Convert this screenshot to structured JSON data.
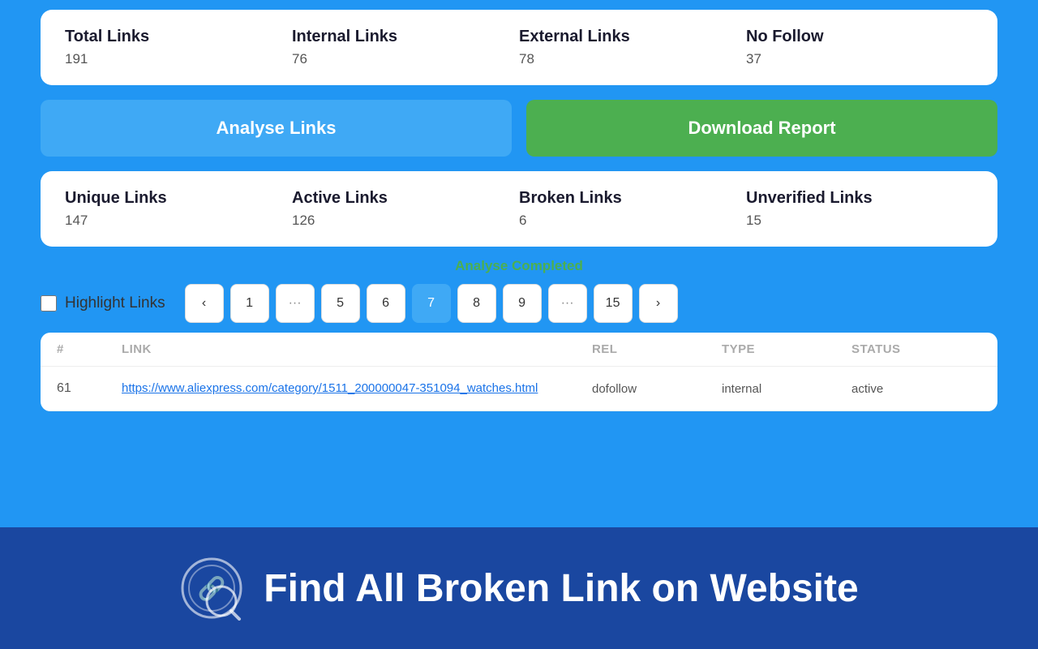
{
  "stats1": {
    "items": [
      {
        "label": "Total Links",
        "value": "191"
      },
      {
        "label": "Internal Links",
        "value": "76"
      },
      {
        "label": "External Links",
        "value": "78"
      },
      {
        "label": "No Follow",
        "value": "37"
      }
    ]
  },
  "buttons": {
    "analyse": "Analyse Links",
    "download": "Download Report"
  },
  "stats2": {
    "items": [
      {
        "label": "Unique Links",
        "value": "147"
      },
      {
        "label": "Active Links",
        "value": "126"
      },
      {
        "label": "Broken Links",
        "value": "6"
      },
      {
        "label": "Unverified Links",
        "value": "15"
      }
    ]
  },
  "status_message": "Analyse Completed",
  "highlight_label": "Highlight Links",
  "pagination": {
    "pages": [
      "<",
      "1",
      "···",
      "5",
      "6",
      "7",
      "8",
      "9",
      "···",
      "15",
      ">"
    ],
    "active": "7"
  },
  "table": {
    "headers": [
      "#",
      "Link",
      "Rel",
      "Type",
      "Status"
    ],
    "rows": [
      {
        "num": "61",
        "link": "https://www.aliexpress.com/category/1511_200000047-351094_watches.html",
        "rel": "dofollow",
        "type": "internal",
        "status": "active"
      }
    ]
  },
  "banner": {
    "text": "Find All Broken Link on Website"
  }
}
